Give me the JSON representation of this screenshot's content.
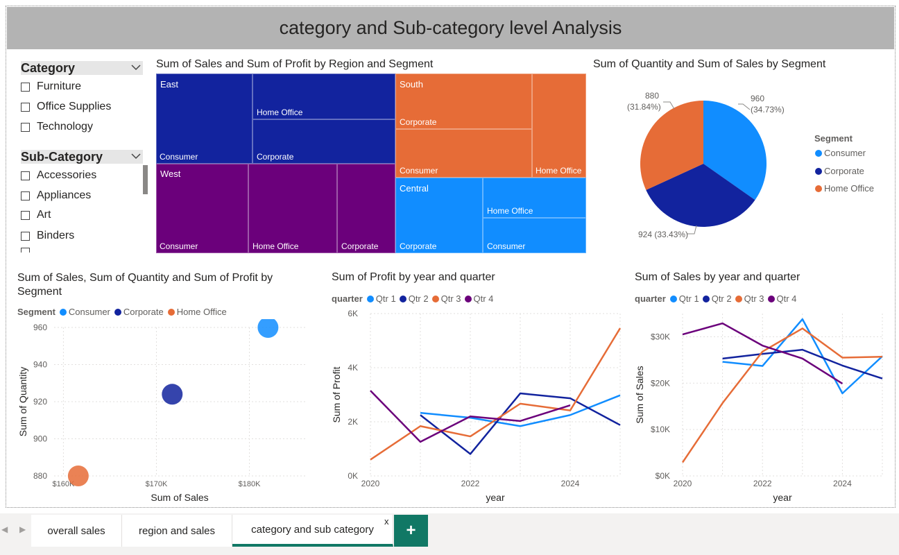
{
  "page_title": "category and Sub-category level Analysis",
  "colors": {
    "consumer": "#118dff",
    "corporate": "#12239e",
    "home_office": "#e66c37",
    "purple": "#6b007b",
    "tab_accent": "#117865"
  },
  "slicers": {
    "category": {
      "label": "Category",
      "items": [
        "Furniture",
        "Office Supplies",
        "Technology"
      ]
    },
    "sub_category": {
      "label": "Sub-Category",
      "items": [
        "Accessories",
        "Appliances",
        "Art",
        "Binders"
      ]
    }
  },
  "treemap": {
    "title": "Sum of Sales and Sum of Profit by Region and Segment",
    "regions": [
      {
        "name": "East",
        "segments": [
          "Consumer",
          "Home Office",
          "Corporate"
        ]
      },
      {
        "name": "South",
        "segments": [
          "Corporate",
          "Consumer",
          "Home Office"
        ]
      },
      {
        "name": "West",
        "segments": [
          "Consumer",
          "Home Office",
          "Corporate"
        ]
      },
      {
        "name": "Central",
        "segments": [
          "Home Office",
          "Corporate",
          "Consumer"
        ]
      }
    ]
  },
  "pie": {
    "title": "Sum of Quantity and Sum of Sales by Segment",
    "legend_title": "Segment",
    "legend": [
      "Consumer",
      "Corporate",
      "Home Office"
    ],
    "labels": {
      "consumer_value": "960",
      "consumer_pct": "(34.73%)",
      "corporate": "924 (33.43%)",
      "home_office_value": "880",
      "home_office_pct": "(31.84%)"
    }
  },
  "scatter": {
    "title": "Sum of Sales, Sum of Quantity and Sum of Profit by Segment",
    "legend_title": "Segment",
    "legend": [
      "Consumer",
      "Corporate",
      "Home Office"
    ],
    "xlabel": "Sum of Sales",
    "ylabel": "Sum of Quantity",
    "xticks": [
      "$160K",
      "$170K",
      "$180K"
    ],
    "yticks": [
      "880",
      "900",
      "920",
      "940",
      "960"
    ]
  },
  "profit_line": {
    "title": "Sum of Profit by year and quarter",
    "legend_title": "quarter",
    "legend": [
      "Qtr 1",
      "Qtr 2",
      "Qtr 3",
      "Qtr 4"
    ],
    "xlabel": "year",
    "ylabel": "Sum of Profit",
    "xticks": [
      "2020",
      "2022",
      "2024"
    ],
    "yticks": [
      "0K",
      "2K",
      "4K",
      "6K"
    ]
  },
  "sales_line": {
    "title": "Sum of Sales by year and quarter",
    "legend_title": "quarter",
    "legend": [
      "Qtr 1",
      "Qtr 2",
      "Qtr 3",
      "Qtr 4"
    ],
    "xlabel": "year",
    "ylabel": "Sum of Sales",
    "xticks": [
      "2020",
      "2022",
      "2024"
    ],
    "yticks": [
      "$0K",
      "$10K",
      "$20K",
      "$30K"
    ]
  },
  "chart_data": [
    {
      "type": "pie",
      "title": "Sum of Quantity and Sum of Sales by Segment",
      "categories": [
        "Consumer",
        "Corporate",
        "Home Office"
      ],
      "values": [
        960,
        924,
        880
      ],
      "percents": [
        34.73,
        33.43,
        31.84
      ]
    },
    {
      "type": "scatter",
      "title": "Sum of Sales, Sum of Quantity and Sum of Profit by Segment",
      "xlabel": "Sum of Sales",
      "ylabel": "Sum of Quantity",
      "xlim": [
        159000,
        186000
      ],
      "ylim": [
        880,
        960
      ],
      "series": [
        {
          "name": "Consumer",
          "x": [
            182000
          ],
          "y": [
            960
          ]
        },
        {
          "name": "Corporate",
          "x": [
            171700
          ],
          "y": [
            924
          ]
        },
        {
          "name": "Home Office",
          "x": [
            161600
          ],
          "y": [
            880
          ]
        }
      ]
    },
    {
      "type": "line",
      "title": "Sum of Profit by year and quarter",
      "xlabel": "year",
      "ylabel": "Sum of Profit",
      "x": [
        2020,
        2021,
        2022,
        2023,
        2024,
        2025
      ],
      "ylim": [
        0,
        6000
      ],
      "series": [
        {
          "name": "Qtr 1",
          "values": [
            null,
            2330,
            2150,
            1840,
            2250,
            2980
          ]
        },
        {
          "name": "Qtr 2",
          "values": [
            null,
            2250,
            810,
            3050,
            2870,
            1880
          ]
        },
        {
          "name": "Qtr 3",
          "values": [
            600,
            1840,
            1460,
            2670,
            2420,
            5460
          ]
        },
        {
          "name": "Qtr 4",
          "values": [
            3150,
            1260,
            2200,
            2030,
            2610,
            null
          ]
        }
      ]
    },
    {
      "type": "line",
      "title": "Sum of Sales by year and quarter",
      "xlabel": "year",
      "ylabel": "Sum of Sales",
      "x": [
        2020,
        2021,
        2022,
        2023,
        2024,
        2025
      ],
      "ylim": [
        0,
        35000
      ],
      "series": [
        {
          "name": "Qtr 1",
          "values": [
            null,
            24600,
            23700,
            33800,
            17800,
            25800
          ]
        },
        {
          "name": "Qtr 2",
          "values": [
            null,
            25300,
            26300,
            27200,
            23800,
            21000
          ]
        },
        {
          "name": "Qtr 3",
          "values": [
            2900,
            15700,
            26800,
            31800,
            25500,
            25700
          ]
        },
        {
          "name": "Qtr 4",
          "values": [
            30500,
            32900,
            28100,
            25300,
            19900,
            null
          ]
        }
      ]
    }
  ],
  "tabs": [
    "overall sales",
    "region and sales",
    "category and sub category"
  ],
  "tab_close": "x",
  "add_tab": "+"
}
